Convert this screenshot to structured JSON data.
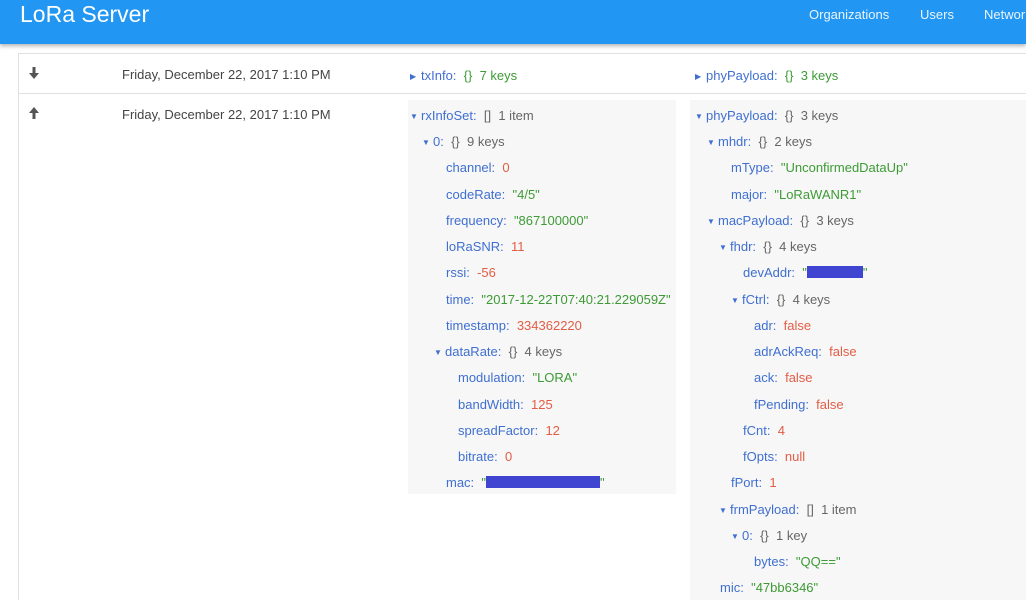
{
  "app": {
    "title": "LoRa Server"
  },
  "nav": [
    {
      "label": "Organizations"
    },
    {
      "label": "Users"
    },
    {
      "label": "Network"
    }
  ],
  "colors": {
    "appbar": "#2196f3",
    "key": "#3f6fd1",
    "string": "#3d9b35",
    "number": "#e35d45",
    "redaction": "#3f45d0"
  },
  "frames": [
    {
      "direction_icon": "arrow-down-icon",
      "timestamp": "Friday, December 22, 2017 1:10 PM",
      "info": {
        "key": "txInfo:",
        "brace": "{}",
        "count": "7 keys",
        "collapsed": true
      },
      "payload": {
        "key": "phyPayload:",
        "brace": "{}",
        "count": "3 keys",
        "collapsed": true
      }
    },
    {
      "direction_icon": "arrow-up-icon",
      "timestamp": "Friday, December 22, 2017 1:10 PM",
      "rxInfoSet": {
        "key": "rxInfoSet:",
        "brace": "[]",
        "count": "1 item",
        "item0": {
          "key": "0:",
          "brace": "{}",
          "count": "9 keys",
          "channel": {
            "key": "channel:",
            "value": "0"
          },
          "codeRate": {
            "key": "codeRate:",
            "value": "\"4/5\""
          },
          "frequency": {
            "key": "frequency:",
            "value": "\"867100000\""
          },
          "loRaSNR": {
            "key": "loRaSNR:",
            "value": "11"
          },
          "rssi": {
            "key": "rssi:",
            "value": "-56"
          },
          "time": {
            "key": "time:",
            "value": "\"2017-12-22T07:40:21.229059Z\""
          },
          "timestamp": {
            "key": "timestamp:",
            "value": "334362220"
          },
          "dataRate": {
            "key": "dataRate:",
            "brace": "{}",
            "count": "4 keys",
            "modulation": {
              "key": "modulation:",
              "value": "\"LORA\""
            },
            "bandWidth": {
              "key": "bandWidth:",
              "value": "125"
            },
            "spreadFactor": {
              "key": "spreadFactor:",
              "value": "12"
            },
            "bitrate": {
              "key": "bitrate:",
              "value": "0"
            }
          },
          "mac": {
            "key": "mac:",
            "open_quote": "\"",
            "close_quote": "\""
          }
        }
      },
      "phyPayload": {
        "key": "phyPayload:",
        "brace": "{}",
        "count": "3 keys",
        "mhdr": {
          "key": "mhdr:",
          "brace": "{}",
          "count": "2 keys",
          "mType": {
            "key": "mType:",
            "value": "\"UnconfirmedDataUp\""
          },
          "major": {
            "key": "major:",
            "value": "\"LoRaWANR1\""
          }
        },
        "macPayload": {
          "key": "macPayload:",
          "brace": "{}",
          "count": "3 keys",
          "fhdr": {
            "key": "fhdr:",
            "brace": "{}",
            "count": "4 keys",
            "devAddr": {
              "key": "devAddr:",
              "open_quote": "\"",
              "close_quote": "\""
            },
            "fCtrl": {
              "key": "fCtrl:",
              "brace": "{}",
              "count": "4 keys",
              "adr": {
                "key": "adr:",
                "value": "false"
              },
              "adrAckReq": {
                "key": "adrAckReq:",
                "value": "false"
              },
              "ack": {
                "key": "ack:",
                "value": "false"
              },
              "fPending": {
                "key": "fPending:",
                "value": "false"
              }
            },
            "fCnt": {
              "key": "fCnt:",
              "value": "4"
            },
            "fOpts": {
              "key": "fOpts:",
              "value": "null"
            }
          },
          "fPort": {
            "key": "fPort:",
            "value": "1"
          },
          "frmPayload": {
            "key": "frmPayload:",
            "brace": "[]",
            "count": "1 item",
            "item0": {
              "key": "0:",
              "brace": "{}",
              "count": "1 key",
              "bytes": {
                "key": "bytes:",
                "value": "\"QQ==\""
              }
            }
          }
        },
        "mic": {
          "key": "mic:",
          "value": "\"47bb6346\""
        }
      }
    }
  ]
}
